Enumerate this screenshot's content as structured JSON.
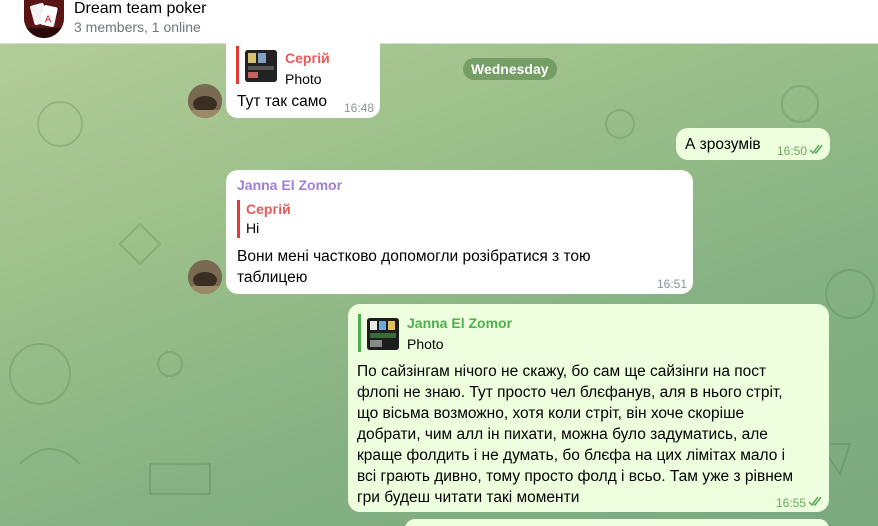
{
  "header": {
    "title": "Dream team poker",
    "subtitle": "3 members, 1 online"
  },
  "date_separator": "Wednesday",
  "messages": [
    {
      "reply_name": "Сергій",
      "reply_text": "Photo",
      "text": "Тут так само",
      "time": "16:48"
    },
    {
      "text": "А зрозумів",
      "time": "16:50"
    },
    {
      "sender": "Janna El Zomor",
      "reply_name": "Сергій",
      "reply_text": "Hi",
      "lines": [
        "Вони мені частково допомогли розібратися з тою",
        "таблицею"
      ],
      "time": "16:51"
    },
    {
      "reply_name": "Janna El Zomor",
      "reply_text": "Photo",
      "lines": [
        "По сайзінгам нічого не скажу, бо сам ще сайзінги на пост",
        "флопі не знаю. Тут просто чел блєфанув, аля в нього стріт,",
        "що вісьма возможно, хотя коли стріт, він хоче скоріше",
        "добрати, чим алл ін пихати, можна було задуматись, але",
        "краще фолдить і не думать, бо блєфа на цих лімітах мало і",
        "всі грають дивно, тому просто фолд і всьо. Там уже з рівнем",
        "гри будеш читати такі моменти"
      ],
      "time": "16:55"
    }
  ],
  "colors": {
    "accent": "#4fae4e",
    "reply_red": "#e85a5a",
    "sender_purple": "#9f7fd8",
    "outgoing_bubble": "#eeffde"
  },
  "icons": {
    "read_receipt": "double-check-icon",
    "group_avatar": "poker-cards-icon"
  }
}
